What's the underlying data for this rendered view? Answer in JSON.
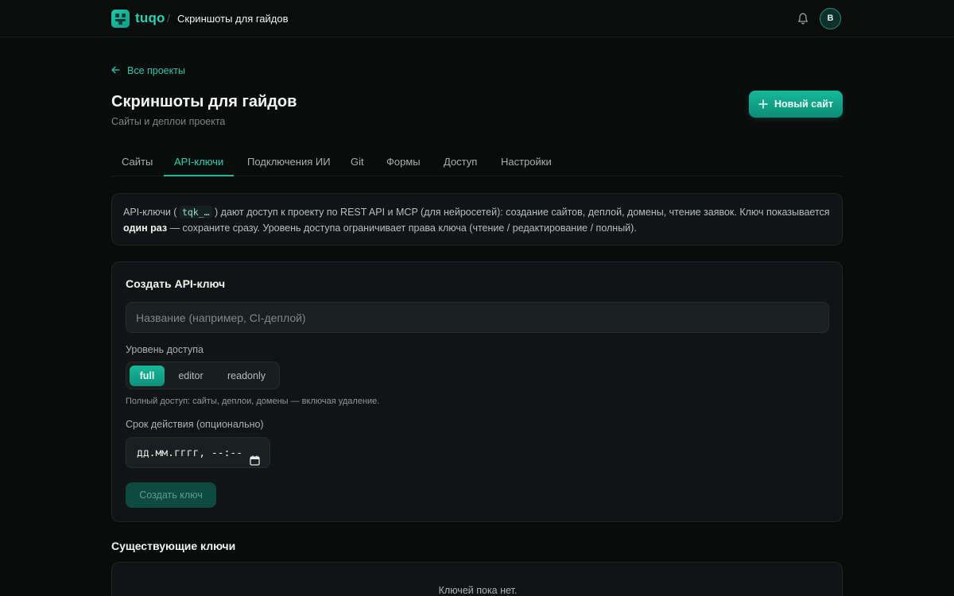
{
  "header": {
    "brand": "tuqo",
    "separator": "/",
    "project": "Скриншоты для гайдов",
    "icons": [
      "logo-icon",
      "bell-icon"
    ],
    "avatar_initial": "B"
  },
  "page": {
    "back_link": "Все проекты",
    "title": "Скриншоты для гайдов",
    "subtitle": "Сайты и деплои проекта",
    "new_site_button": "Новый сайт"
  },
  "tabs": [
    {
      "label": "Сайты"
    },
    {
      "label": "API-ключи",
      "active": true
    },
    {
      "label": "Подключения ИИ"
    },
    {
      "label": "Git"
    },
    {
      "label": "Формы"
    },
    {
      "label": "Доступ"
    },
    {
      "label": "Настройки"
    }
  ],
  "info": {
    "part1": "API-ключи (",
    "code": "tqk_…",
    "part2": ") дают доступ к проекту по REST API и MCP (для нейросетей): создание сайтов, деплой, домены, чтение заявок. Ключ показывается",
    "bold": "один раз",
    "part3": "— сохраните сразу. Уровень доступа ограничивает права ключа (чтение / редактирование / полный)."
  },
  "create": {
    "title": "Создать API-ключ",
    "name_placeholder": "Название (например, CI-деплой)",
    "name_value": "",
    "level_label": "Уровень доступа",
    "levels": [
      "full",
      "editor",
      "readonly"
    ],
    "selected_level": "full",
    "level_description": "Полный доступ: сайты, деплои, домены — включая удаление.",
    "expiry_label": "Срок действия (опционально)",
    "expiry_placeholder": "дд.мм.гггг, --:--",
    "submit": "Создать ключ"
  },
  "existing": {
    "title": "Существующие ключи",
    "empty": "Ключей пока нет."
  },
  "colors": {
    "accent": "#27d3b3",
    "background": "#0a0c0c",
    "card": "#111414"
  }
}
